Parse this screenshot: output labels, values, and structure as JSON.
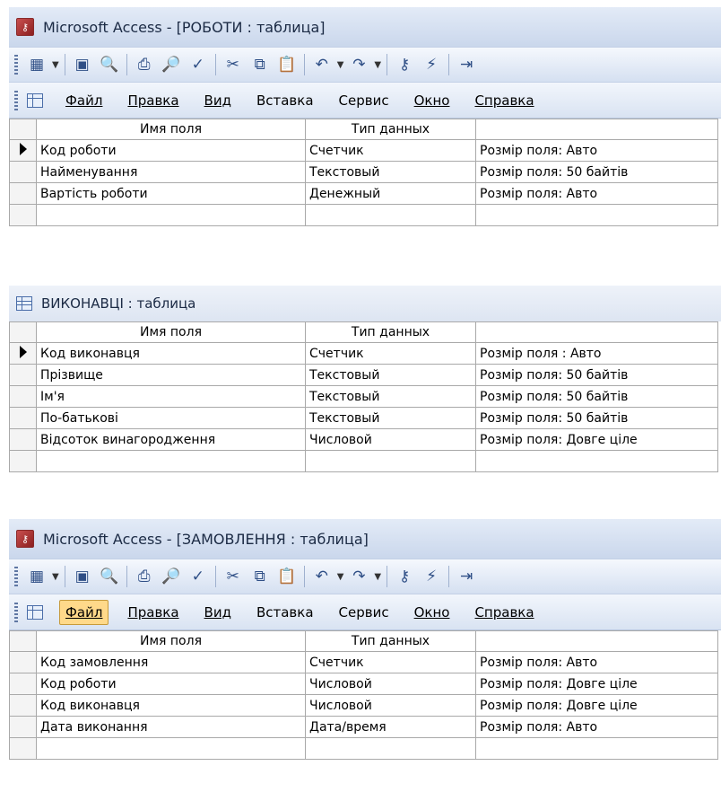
{
  "windows": [
    {
      "title": "Microsoft Access - [РОБОТИ : таблица]",
      "menu": [
        "Файл",
        "Правка",
        "Вид",
        "Вставка",
        "Сервис",
        "Окно",
        "Справка"
      ],
      "headers": [
        "Имя поля",
        "Тип данных",
        ""
      ],
      "rows": [
        [
          "Код роботи",
          "Счетчик",
          "Розмір поля: Авто"
        ],
        [
          "Найменування",
          "Текстовый",
          "Розмір поля: 50 байтів"
        ],
        [
          "Вартість роботи",
          "Денежный",
          "Розмір поля: Авто"
        ],
        [
          "",
          "",
          ""
        ]
      ]
    },
    {
      "title": "ВИКОНАВЦІ : таблица",
      "headers": [
        "Имя поля",
        "Тип данных",
        ""
      ],
      "rows": [
        [
          "Код виконавця",
          "Счетчик",
          "Розмір поля : Авто"
        ],
        [
          "Прізвище",
          "Текстовый",
          "Розмір поля: 50 байтів"
        ],
        [
          "Ім'я",
          "Текстовый",
          "Розмір поля: 50 байтів"
        ],
        [
          "По-батькові",
          "Текстовый",
          "Розмір поля: 50 байтів"
        ],
        [
          "Відсоток винагородження",
          "Числовой",
          "Розмір поля: Довге ціле"
        ],
        [
          "",
          "",
          ""
        ]
      ]
    },
    {
      "title": "Microsoft Access - [ЗАМОВЛЕННЯ : таблица]",
      "menu": [
        "Файл",
        "Правка",
        "Вид",
        "Вставка",
        "Сервис",
        "Окно",
        "Справка"
      ],
      "headers": [
        "Имя поля",
        "Тип данных",
        ""
      ],
      "rows": [
        [
          "Код замовлення",
          "Счетчик",
          "Розмір поля: Авто"
        ],
        [
          "Код роботи",
          "Числовой",
          "Розмір поля: Довге ціле"
        ],
        [
          "Код виконавця",
          "Числовой",
          "Розмір поля: Довге ціле"
        ],
        [
          "Дата виконання",
          "Дата/время",
          "Розмір поля: Авто"
        ],
        [
          "",
          "",
          ""
        ]
      ]
    }
  ],
  "icons": {
    "app": "access-key-icon",
    "table": "table-icon"
  },
  "colors": {
    "title_bg": "#cad7ec",
    "toolbar_bg": "#d5e0f1",
    "active_menu": "#ffd98a"
  }
}
